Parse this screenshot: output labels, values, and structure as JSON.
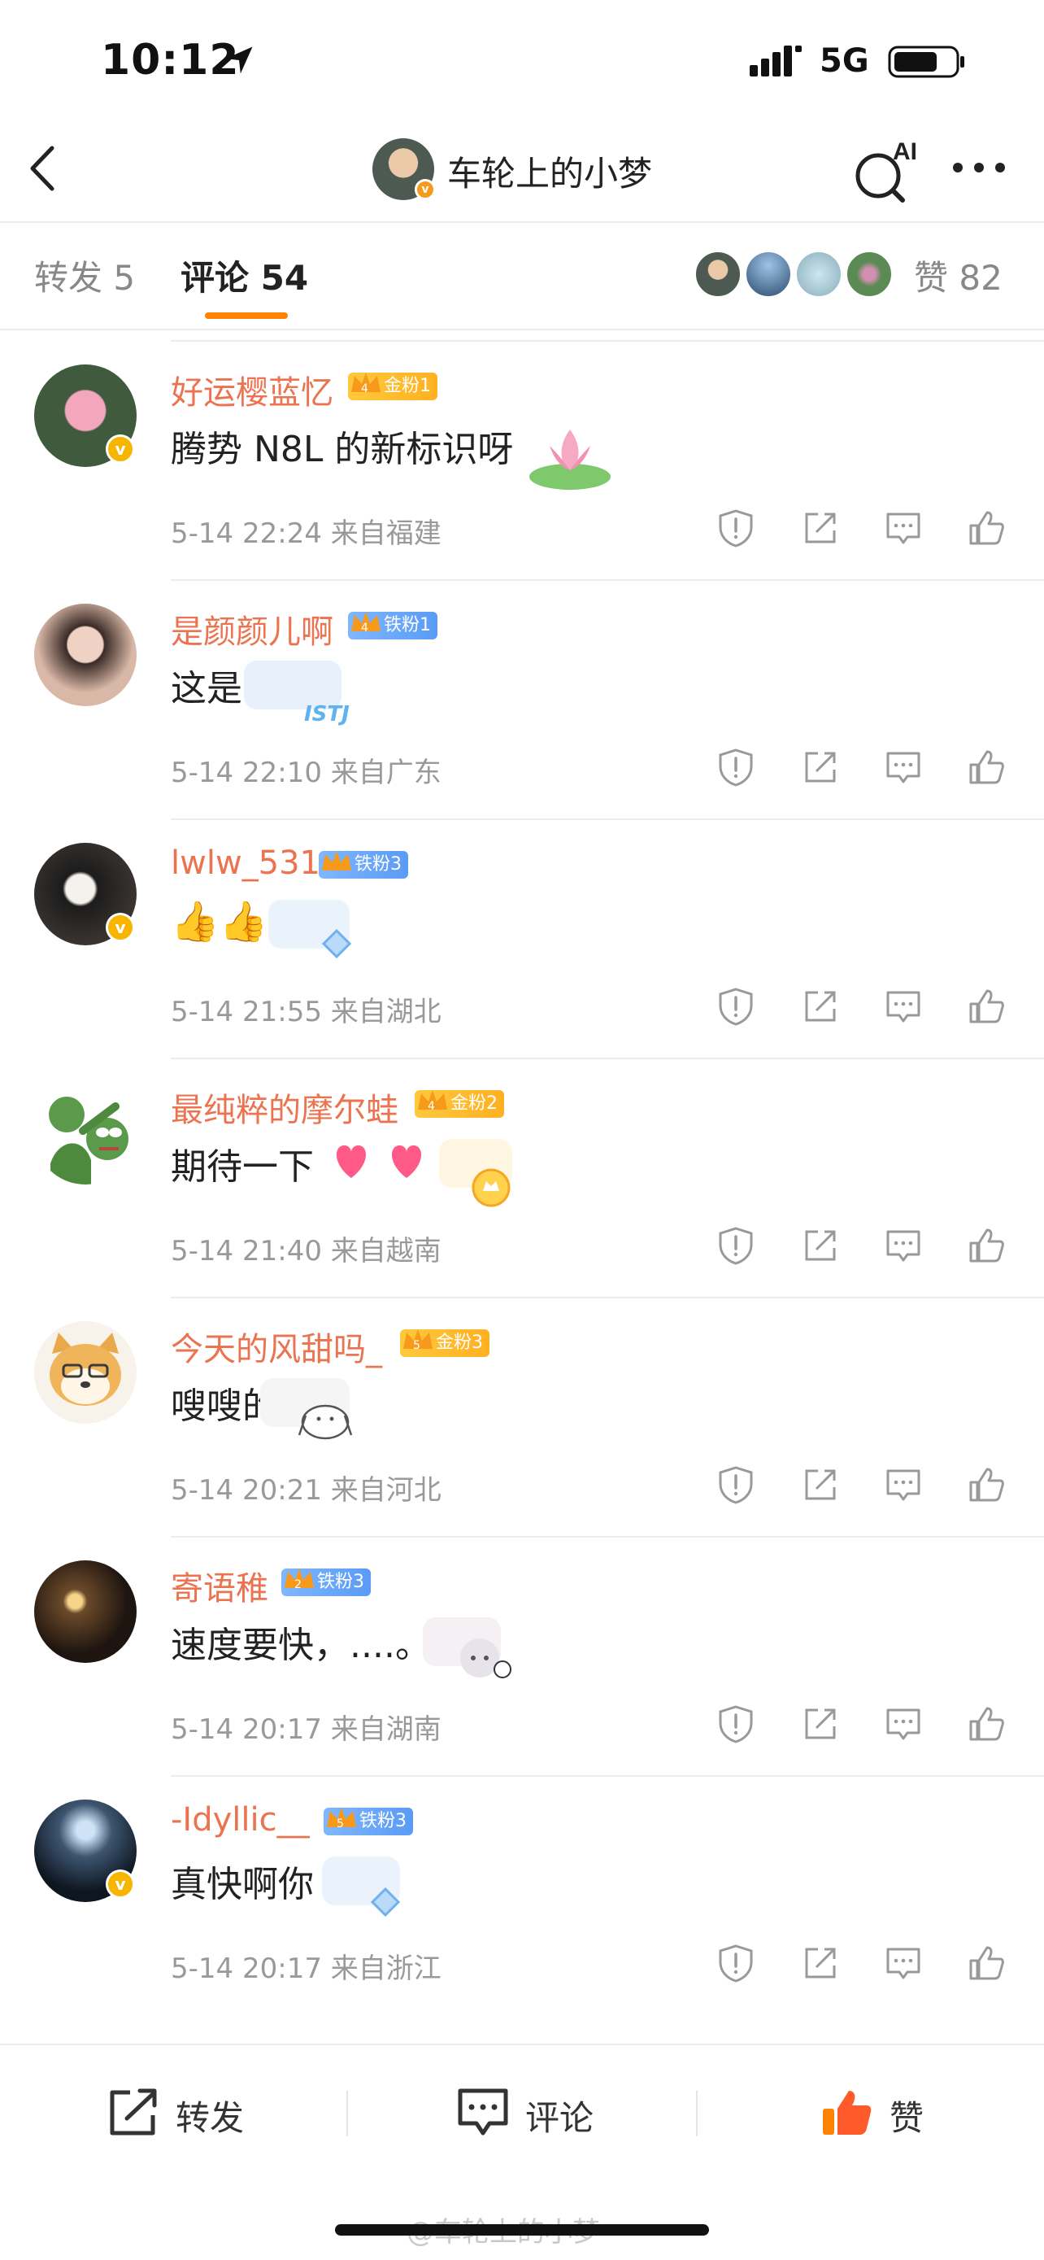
{
  "status_bar": {
    "time": "10:12",
    "network": "5G"
  },
  "nav": {
    "title": "车轮上的小梦",
    "ai_label": "AI",
    "verified_badge": "v"
  },
  "tabs": {
    "repost": "转发 5",
    "comment": "评论 54",
    "like": "赞 82"
  },
  "comments": [
    {
      "name": "好运樱蓝忆",
      "fan_badge": "金粉1",
      "fan_level": "4",
      "text": "腾势 N8L 的新标识呀",
      "meta": "5-14 22:24  来自福建",
      "verified": true
    },
    {
      "name": "是颜颜儿啊",
      "fan_badge": "铁粉1",
      "fan_level": "4",
      "text": "这是啥",
      "meta": "5-14 22:10  来自广东",
      "verified": false
    },
    {
      "name": "lwlw_531",
      "fan_badge": "铁粉3",
      "fan_level": "",
      "text": "👍👍",
      "meta": "5-14 21:55  来自湖北",
      "verified": true
    },
    {
      "name": "最纯粹的摩尔蛙",
      "fan_badge": "金粉2",
      "fan_level": "4",
      "text": "期待一下",
      "meta": "5-14 21:40  来自越南",
      "verified": false
    },
    {
      "name": "今天的风甜吗_",
      "fan_badge": "金粉3",
      "fan_level": "5",
      "text": "嗖嗖的",
      "meta": "5-14 20:21  来自河北",
      "verified": false
    },
    {
      "name": "寄语稚",
      "fan_badge": "铁粉3",
      "fan_level": "2",
      "text": "速度要快，....。",
      "meta": "5-14 20:17  来自湖南",
      "verified": false
    },
    {
      "name": "-Idyllic__",
      "fan_badge": "铁粉3",
      "fan_level": "5",
      "text": "真快啊你",
      "meta": "5-14 20:17  来自浙江",
      "verified": true
    }
  ],
  "bottom_bar": {
    "repost": "转发",
    "comment": "评论",
    "like": "赞"
  },
  "watermark": "@车轮上的小梦",
  "colors": {
    "accent": "#ff8200",
    "username": "#eb7350",
    "meta": "#999999",
    "gold_fan": "#ffb020",
    "iron_fan": "#5a9bf5"
  },
  "icons": {
    "comment_actions": [
      "report-icon",
      "share-icon",
      "reply-icon",
      "like-icon"
    ],
    "bottom_bar": [
      "repost-icon",
      "comment-icon",
      "like-icon"
    ]
  }
}
